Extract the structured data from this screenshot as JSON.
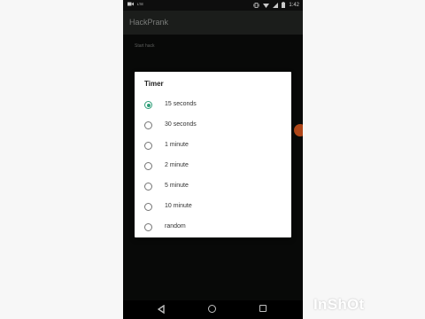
{
  "status_bar": {
    "carrier": "LTE",
    "time": "1:42"
  },
  "app_bar": {
    "title": "HackPrank"
  },
  "settings": {
    "start_hack_label": "Start hack"
  },
  "dialog": {
    "title": "Timer",
    "options": [
      {
        "label": "15 seconds",
        "selected": true
      },
      {
        "label": "30 seconds",
        "selected": false
      },
      {
        "label": "1 minute",
        "selected": false
      },
      {
        "label": "2 minute",
        "selected": false
      },
      {
        "label": "5 minute",
        "selected": false
      },
      {
        "label": "10 minute",
        "selected": false
      },
      {
        "label": "random",
        "selected": false
      }
    ]
  },
  "navigation": {
    "icons": [
      "back-icon",
      "home-icon",
      "recents-icon"
    ]
  },
  "watermark": {
    "text": "InShOt"
  },
  "colors": {
    "accent": "#2e9e78",
    "app_bar": "#1f211f",
    "background": "#0a0b0a",
    "knob": "#c8501d"
  }
}
